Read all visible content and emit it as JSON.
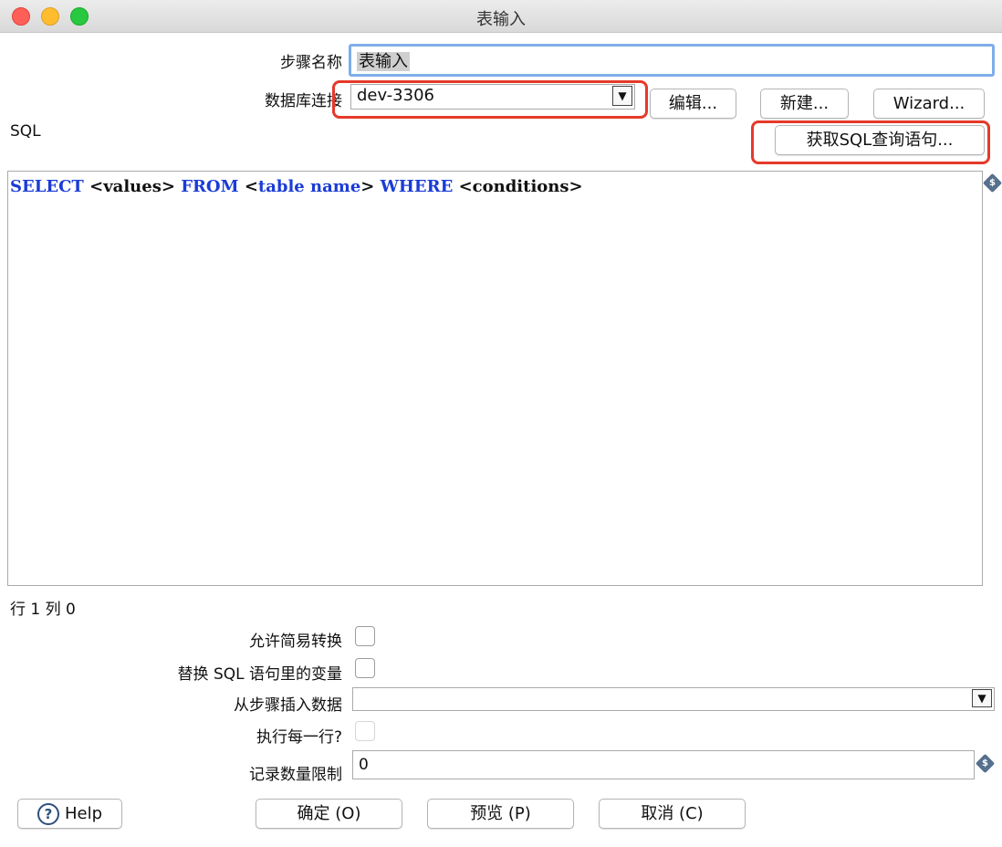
{
  "window": {
    "title": "表输入"
  },
  "form": {
    "step_name_label": "步骤名称",
    "step_name_value": "表输入",
    "db_conn_label": "数据库连接",
    "db_conn_value": "dev-3306",
    "edit_btn": "编辑...",
    "new_btn": "新建...",
    "wizard_btn": "Wizard...",
    "sql_label": "SQL",
    "get_sql_btn": "获取SQL查询语句..."
  },
  "sql": {
    "tokens": [
      "SELECT",
      "<values>",
      "FROM",
      "<",
      "table",
      "name",
      ">",
      "WHERE",
      "<conditions>"
    ]
  },
  "status": {
    "cursor": "行 1 列 0"
  },
  "options": {
    "lazy_conversion_label": "允许简易转换",
    "replace_vars_label": "替换 SQL 语句里的变量",
    "insert_from_step_label": "从步骤插入数据",
    "insert_from_step_value": "",
    "execute_each_row_label": "执行每一行?",
    "limit_label": "记录数量限制",
    "limit_value": "0"
  },
  "icons": {
    "variable_icon": "dollar-diamond-icon",
    "help_icon": "question-circle-icon",
    "dropdown_icon": "triangle-down-icon"
  },
  "colors": {
    "highlight": "#e53a2a",
    "keyword": "#1a3cd6",
    "focus_ring": "#7fadea"
  },
  "buttons": {
    "help": "Help",
    "ok": "确定 (O)",
    "preview": "预览 (P)",
    "cancel": "取消 (C)"
  }
}
